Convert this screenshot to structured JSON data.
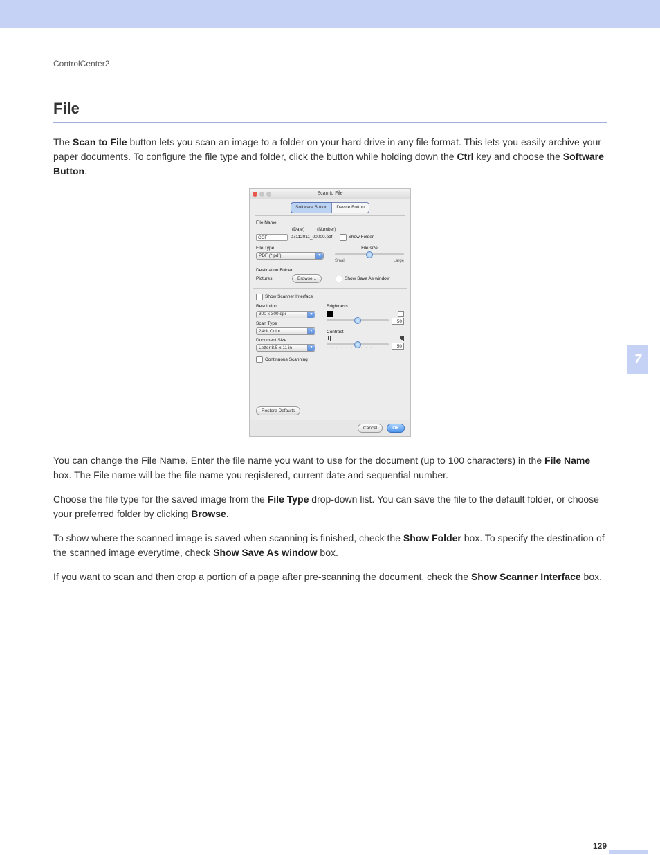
{
  "header": {
    "breadcrumb": "ControlCenter2"
  },
  "section": {
    "title": "File"
  },
  "paras": {
    "intro_pre": "The ",
    "intro_bold": "Scan to File",
    "intro_post1": " button lets you scan an image to a folder on your hard drive in any file format. This lets you easily archive your paper documents. To configure the file type and folder, click the button while holding down the ",
    "intro_bold2": "Ctrl",
    "intro_mid": " key and choose the ",
    "intro_bold3": "Software Button",
    "intro_end": ".",
    "p2a": "You can change the File Name. Enter the file name you want to use for the document (up to 100 characters) in the ",
    "p2b": "File Name",
    "p2c": " box. The File name will be the file name you registered, current date and sequential number.",
    "p3a": "Choose the file type for the saved image from the ",
    "p3b": "File Type",
    "p3c": " drop-down list. You can save the file to the default folder, or choose your preferred folder by clicking ",
    "p3d": "Browse",
    "p3e": ".",
    "p4a": "To show where the scanned image is saved when scanning is finished, check the ",
    "p4b": "Show Folder",
    "p4c": " box. To specify the destination of the scanned image everytime, check ",
    "p4d": "Show Save As window",
    "p4e": " box.",
    "p5a": "If you want to scan and then crop a portion of a page after pre-scanning the document, check the ",
    "p5b": "Show Scanner Interface",
    "p5c": " box."
  },
  "dlg": {
    "title": "Scan to File",
    "tabs": {
      "software": "Software Button",
      "device": "Device Button"
    },
    "file_name_label": "File Name",
    "date_lbl": "(Date)",
    "number_lbl": "(Number)",
    "file_name_value": "CCF",
    "gen_name": "07112011_00000.pdf",
    "show_folder": "Show Folder",
    "file_type_label": "File Type",
    "file_type_value": "PDF (*.pdf)",
    "file_size_label": "File size",
    "small": "Small",
    "large": "Large",
    "dest_label": "Destination Folder",
    "dest_value": "Pictures",
    "browse": "Browse...",
    "show_save_as": "Show Save As window",
    "show_scanner": "Show Scanner Interface",
    "resolution_label": "Resolution",
    "resolution_value": "300 x 300 dpi",
    "scan_type_label": "Scan Type",
    "scan_type_value": "24bit Color",
    "doc_size_label": "Document Size",
    "doc_size_value": "Letter 8.5 x 11 in",
    "brightness_label": "Brightness",
    "brightness_value": "50",
    "contrast_label": "Contrast",
    "contrast_value": "50",
    "continuous": "Continuous Scanning",
    "restore": "Restore Defaults",
    "cancel": "Cancel",
    "ok": "OK"
  },
  "chapter_tab": "7",
  "page_number": "129"
}
